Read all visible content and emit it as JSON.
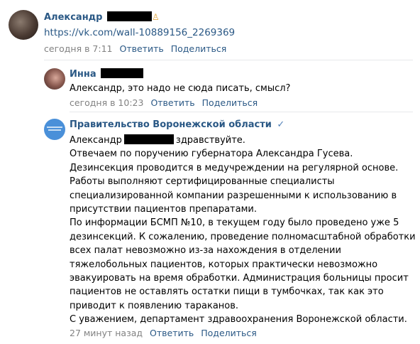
{
  "comments": [
    {
      "author": "Александр",
      "text": "https://vk.com/wall-10889156_2269369",
      "time": "сегодня в 7:11",
      "reply_label": "Ответить",
      "share_label": "Поделиться"
    },
    {
      "author": "Инна",
      "text": "Александр, это надо не сюда писать, смысл?",
      "time": "сегодня в 10:23",
      "reply_label": "Ответить",
      "share_label": "Поделиться"
    },
    {
      "author": "Правительство Воронежской области",
      "address": "Александр",
      "greeting": "здравствуйте.",
      "lines": [
        "Отвечаем по поручению губернатора Александра Гусева.",
        "Дезинсекция проводится в медучреждении на регулярной основе.",
        "Работы выполняют сертифицированные специалисты",
        "специализированной компании разрешенными к использованию в",
        "присутствии пациентов препаратами.",
        "По информации БСМП №10, в текущем году было проведено уже 5",
        "дезинсекций. К сожалению, проведение полномасштабной обработки",
        "всех палат невозможно из-за нахождения в отделении",
        "тяжелобольных пациентов, которых практически невозможно",
        "эвакуировать на время обработки. Администрация больницы просит",
        "пациентов не оставлять остатки пищи в тумбочках, так как это",
        "приводит к появлению тараканов.",
        "С уважением, департамент здравоохранения Воронежской области."
      ],
      "time": "27 минут назад",
      "reply_label": "Ответить",
      "share_label": "Поделиться",
      "verified_icon": "checkmark-icon"
    }
  ],
  "colors": {
    "link": "#2a5885",
    "meta": "#828282",
    "divider": "#e7e8ec",
    "gov_avatar": "#4a90d9"
  }
}
